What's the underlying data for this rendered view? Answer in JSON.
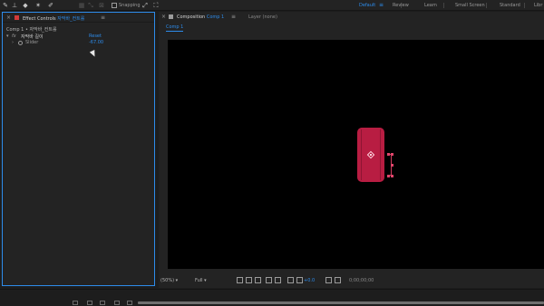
{
  "toolbar": {
    "tools": [
      "pen-tool-icon",
      "puppet-tool-icon",
      "fill-tool-icon",
      "star-tool-icon",
      "pin-tool-icon"
    ],
    "snapping_label": "Snapping",
    "workspaces": [
      "Default",
      "Review",
      "Learn",
      "Small Screen",
      "Standard",
      "Libr"
    ],
    "active_workspace": "Default",
    "workspace_menu_icon": "hamburger-icon"
  },
  "effect_controls": {
    "title_prefix": "Effect Controls",
    "layer_name": "자막바_컨트롤",
    "comp_line": "Comp 1 • 자막바_컨트롤",
    "effect": {
      "fx_label": "fx",
      "name": "자막바 길이",
      "reset_label": "Reset"
    },
    "slider": {
      "name": "Slider",
      "value": "-67.00"
    }
  },
  "composition": {
    "title_prefix": "Composition",
    "comp_name": "Comp 1",
    "layer_tab": "Layer (none)",
    "subtab": "Comp 1",
    "object_color": "#b81d42"
  },
  "viewer_controls": {
    "zoom": "(50%)",
    "resolution": "Full",
    "exposure": "+0.0",
    "timecode": "0;00;00;00"
  },
  "colors": {
    "accent": "#2d8ceb",
    "panel": "#232323",
    "background": "#1d1d1d"
  }
}
